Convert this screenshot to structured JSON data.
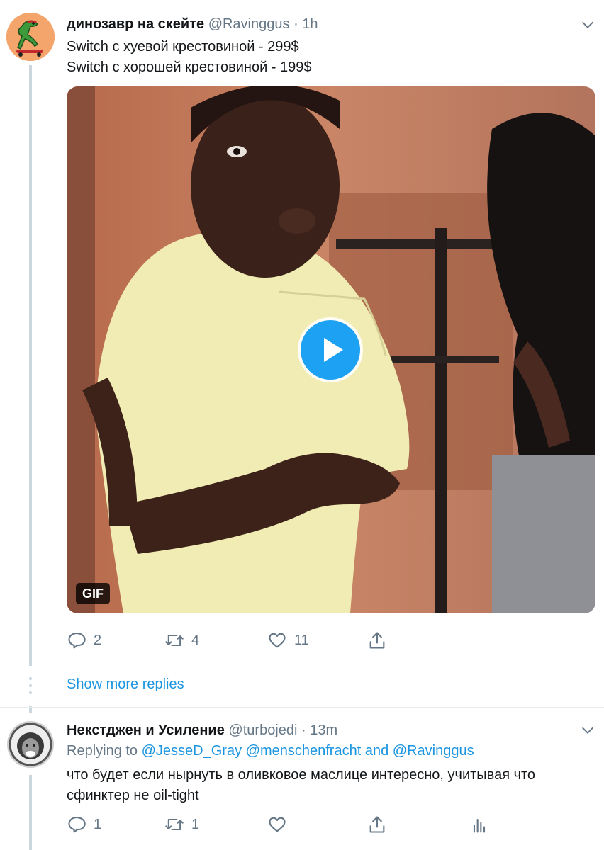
{
  "tweet1": {
    "display_name": "динозавр на скейте",
    "handle": "@Ravinggus",
    "separator": "·",
    "time": "1h",
    "lines": [
      "Switch с хуевой крестовиной - 299$",
      "Switch с хорошей крестовиной - 199$"
    ],
    "media_badge": "GIF",
    "actions": {
      "replies": "2",
      "retweets": "4",
      "likes": "11"
    }
  },
  "show_more": "Show more replies",
  "tweet2": {
    "display_name": "Некстджен и Усиление",
    "handle": "@turbojedi",
    "separator": "·",
    "time": "13m",
    "replying_prefix": "Replying to",
    "mention1": "@JesseD_Gray",
    "mention2": "@menschenfracht",
    "and_text": "and",
    "mention3": "@Ravinggus",
    "lines": [
      "что будет если нырнуть в оливковое маслице интересно, учитывая что",
      "сфинктер не oil-tight"
    ],
    "actions": {
      "replies": "1",
      "retweets": "1"
    }
  },
  "colors": {
    "accent": "#1da1f2",
    "link": "#1b95e0",
    "muted": "#657786",
    "thread": "#ccd6dd"
  },
  "icons": [
    "chevron-down-icon",
    "reply-icon",
    "retweet-icon",
    "like-icon",
    "share-icon",
    "analytics-icon",
    "play-icon"
  ]
}
